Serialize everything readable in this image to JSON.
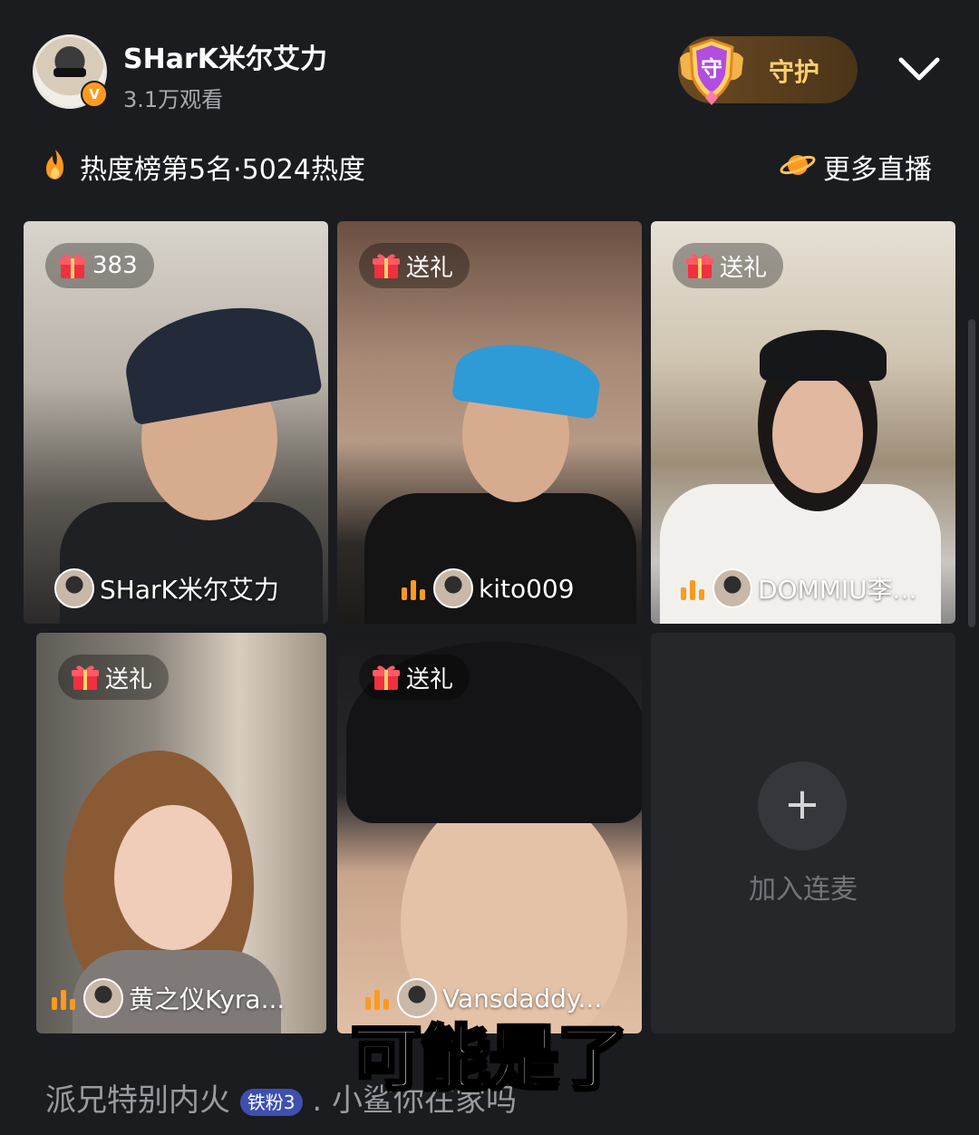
{
  "header": {
    "host_name": "SHarK米尔艾力",
    "viewers": "3.1万观看",
    "verified_badge": "V",
    "guard_label": "守护",
    "guard_shield_char": "守"
  },
  "heat": {
    "text": "热度榜第5名·5024热度",
    "more_label": "更多直播"
  },
  "tiles": [
    {
      "gift_label": "383",
      "name": "SHarK米尔艾力"
    },
    {
      "gift_label": "送礼",
      "name": "kito009"
    },
    {
      "gift_label": "送礼",
      "name": "DOMMIU李..."
    },
    {
      "gift_label": "送礼",
      "name": "黄之仪Kyra..."
    },
    {
      "gift_label": "送礼",
      "name": "Vansdaddy..."
    }
  ],
  "join": {
    "plus": "+",
    "label": "加入连麦"
  },
  "comment": {
    "prefix": "派兄特别内火",
    "badge": "铁粉3",
    "suffix": ". 小鲨你在家吗"
  },
  "subtitle": "可能是了",
  "colors": {
    "background": "#1b1c20",
    "guard_gold": "#ffcf6b",
    "gift_red": "#f0303e",
    "signal_orange": "#ff9a1f"
  }
}
